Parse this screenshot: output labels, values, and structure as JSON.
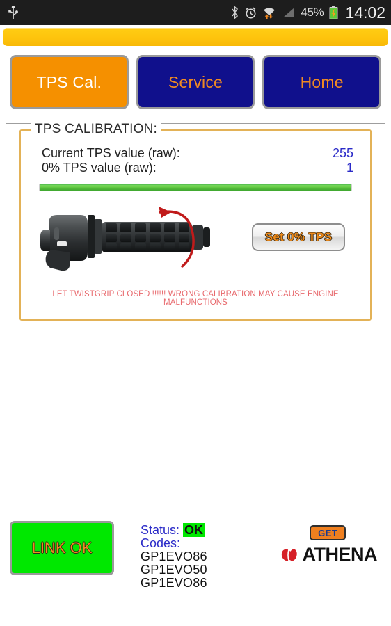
{
  "statusbar": {
    "icons_left": [
      "usb-icon"
    ],
    "icons_right": [
      "bluetooth-icon",
      "alarm-icon",
      "wifi-icon",
      "signal-icon",
      "battery-charging-icon"
    ],
    "battery_percent": "45%",
    "time": "14:02"
  },
  "tabs": [
    {
      "label": "TPS Cal.",
      "state": "active"
    },
    {
      "label": "Service",
      "state": "idle"
    },
    {
      "label": "Home",
      "state": "idle"
    }
  ],
  "panel": {
    "legend": "TPS CALIBRATION:",
    "rows": [
      {
        "label": "Current TPS value (raw):",
        "value": "255"
      },
      {
        "label": "0% TPS value (raw):",
        "value": "1"
      }
    ],
    "progress_percent": 100,
    "illustration": "throttle-twistgrip-illustration",
    "set_zero_button": "Set 0% TPS",
    "warning": "LET TWISTGRIP CLOSED !!!!!! WRONG CALIBRATION MAY CAUSE ENGINE MALFUNCTIONS"
  },
  "bottom": {
    "link_button": "LINK OK",
    "status_label": "Status:",
    "status_value": "OK",
    "codes_label": "Codes:",
    "codes": [
      "GP1EVO86",
      "GP1EVO50",
      "GP1EVO86"
    ],
    "brand_badge": "GET",
    "brand_name": "ATHENA"
  },
  "colors": {
    "accent_orange": "#f59000",
    "tab_blue": "#10108c",
    "panel_border": "#e3b257",
    "progress_green": "#5cc33e",
    "link_green": "#00e800",
    "value_blue": "#2b2bc8",
    "warning_red": "#e8696d",
    "titlebar_yellow": "#fec40d"
  }
}
